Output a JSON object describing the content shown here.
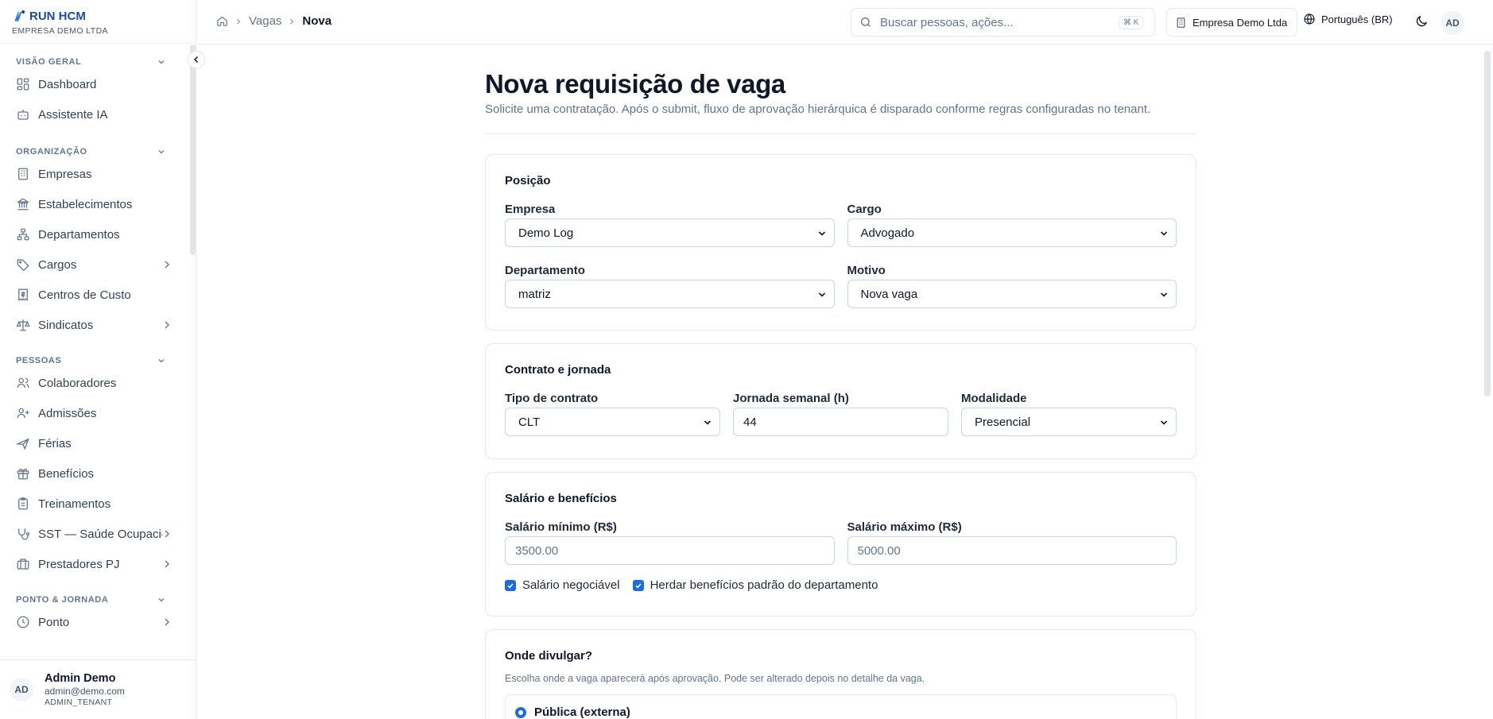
{
  "brand": {
    "name": "RUN HCM",
    "tenant": "EMPRESA DEMO LTDA"
  },
  "sidebar": {
    "sections": [
      {
        "title": "VISÃO GERAL",
        "items": [
          {
            "label": "Dashboard",
            "icon": "dashboard-icon"
          },
          {
            "label": "Assistente IA",
            "icon": "bot-icon"
          }
        ]
      },
      {
        "title": "ORGANIZAÇÃO",
        "items": [
          {
            "label": "Empresas",
            "icon": "building-icon"
          },
          {
            "label": "Estabelecimentos",
            "icon": "landmark-icon"
          },
          {
            "label": "Departamentos",
            "icon": "network-icon"
          },
          {
            "label": "Cargos",
            "icon": "tag-icon"
          },
          {
            "label": "Centros de Custo",
            "icon": "receipt-icon"
          },
          {
            "label": "Sindicatos",
            "icon": "scale-icon"
          }
        ]
      },
      {
        "title": "PESSOAS",
        "items": [
          {
            "label": "Colaboradores",
            "icon": "users-icon"
          },
          {
            "label": "Admissões",
            "icon": "user-plus-icon"
          },
          {
            "label": "Férias",
            "icon": "plane-icon"
          },
          {
            "label": "Benefícios",
            "icon": "gift-icon"
          },
          {
            "label": "Treinamentos",
            "icon": "clipboard-icon"
          },
          {
            "label": "SST — Saúde Ocupacional",
            "icon": "stethoscope-icon"
          },
          {
            "label": "Prestadores PJ",
            "icon": "briefcase-icon"
          }
        ]
      },
      {
        "title": "PONTO & JORNADA",
        "items": [
          {
            "label": "Ponto",
            "icon": "clock-icon"
          }
        ]
      }
    ]
  },
  "user": {
    "initials": "AD",
    "name": "Admin Demo",
    "email": "admin@demo.com",
    "role": "ADMIN_TENANT"
  },
  "breadcrumb": {
    "parent": "Vagas",
    "current": "Nova"
  },
  "search": {
    "placeholder": "Buscar pessoas, ações...",
    "shortcut": "⌘ K"
  },
  "tenant_selector": "Empresa Demo Ltda",
  "language": "Português (BR)",
  "page": {
    "title": "Nova requisição de vaga",
    "description": "Solicite uma contratação. Após o submit, fluxo de aprovação hierárquica é disparado conforme regras configuradas no tenant."
  },
  "posicao": {
    "title": "Posição",
    "empresa": {
      "label": "Empresa",
      "value": "Demo Log"
    },
    "cargo": {
      "label": "Cargo",
      "value": "Advogado"
    },
    "departamento": {
      "label": "Departamento",
      "value": "matriz"
    },
    "motivo": {
      "label": "Motivo",
      "value": "Nova vaga"
    }
  },
  "contrato": {
    "title": "Contrato e jornada",
    "tipo": {
      "label": "Tipo de contrato",
      "value": "CLT"
    },
    "jornada": {
      "label": "Jornada semanal (h)",
      "value": "44"
    },
    "modalidade": {
      "label": "Modalidade",
      "value": "Presencial"
    }
  },
  "salario": {
    "title": "Salário e benefícios",
    "minimo": {
      "label": "Salário mínimo (R$)",
      "placeholder": "3500.00"
    },
    "maximo": {
      "label": "Salário máximo (R$)",
      "placeholder": "5000.00"
    },
    "negociavel": {
      "label": "Salário negociável",
      "checked": true
    },
    "herdar": {
      "label": "Herdar benefícios padrão do departamento",
      "checked": true
    }
  },
  "divulgar": {
    "title": "Onde divulgar?",
    "hint": "Escolha onde a vaga aparecerá após aprovação. Pode ser alterado depois no detalhe da vaga.",
    "option": "Pública (externa)"
  },
  "colors": {
    "accent": "#1d6ae5",
    "brand": "#1e4a9c"
  }
}
